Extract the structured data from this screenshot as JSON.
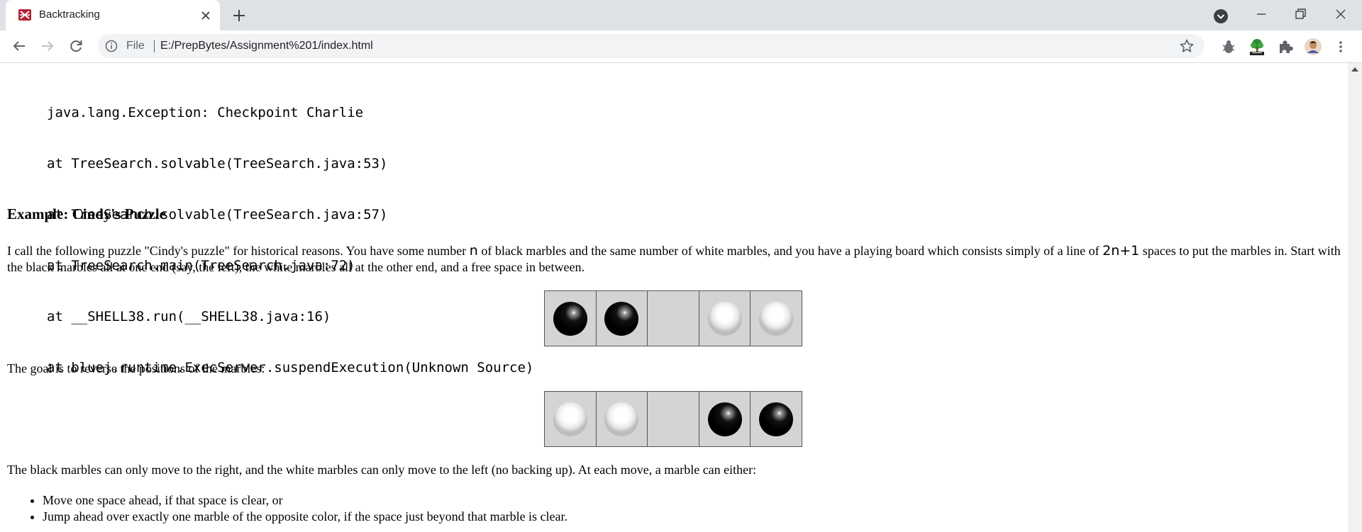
{
  "browser": {
    "tab_title": "Backtracking",
    "address_scheme": "File",
    "url": "E:/PrepBytes/Assignment%201/index.html"
  },
  "page": {
    "stack_trace": [
      "java.lang.Exception: Checkpoint Charlie",
      "at TreeSearch.solvable(TreeSearch.java:53)",
      "at TreeSearch.solvable(TreeSearch.java:57)",
      "at TreeSearch.main(TreeSearch.java:72)",
      "at __SHELL38.run(__SHELL38.java:16)",
      "at bluej.runtime.ExecServer.suspendExecution(Unknown Source)"
    ],
    "heading": "Example: Cindy's Puzzle",
    "intro": {
      "part1": "I call the following puzzle \"Cindy's puzzle\" for historical reasons. You have some number ",
      "var_n": "n",
      "part2": " of black marbles and the same number of white marbles, and you have a playing board which consists simply of a line of ",
      "var_2n1": "2n+1",
      "part3": " spaces to put the marbles in. Start with the black marbles all at one end (say, the left), the white marbles all at the other end, and a free space in between."
    },
    "start_board": [
      "black",
      "black",
      "empty",
      "white",
      "white"
    ],
    "goal_text": "The goal is to reverse the positions of the marbles:",
    "goal_board": [
      "white",
      "white",
      "empty",
      "black",
      "black"
    ],
    "moves_text": "The black marbles can only move to the right, and the white marbles can only move to the left (no backing up). At each move, a marble can either:",
    "rules": [
      "Move one space ahead, if that space is clear, or",
      "Jump ahead over exactly one marble of the opposite color, if the space just beyond that marble is clear."
    ]
  }
}
